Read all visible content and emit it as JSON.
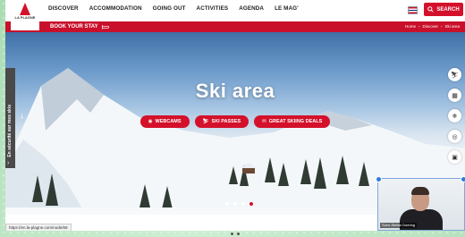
{
  "nav": {
    "items": [
      "DISCOVER",
      "ACCOMMODATION",
      "GOING OUT",
      "ACTIVITIES",
      "AGENDA",
      "LE MAG'"
    ],
    "search_label": "SEARCH"
  },
  "logo": {
    "text": "LA PLAGNE"
  },
  "subbar": {
    "book_label": "BOOK YOUR STAY",
    "breadcrumb": [
      "Home",
      "Discover",
      "Ski area"
    ]
  },
  "hero": {
    "title": "Ski area",
    "buttons": [
      "WEBCAMS",
      "SKI PASSES",
      "GREAT SKIING DEALS"
    ],
    "side_tab": "En sécurité sur mes skis",
    "slides": 4,
    "active_slide": 4
  },
  "status_bar": {
    "url": "https://en.la-plagne.com/node/69"
  },
  "video": {
    "name": "Sven-Stefan Doering"
  },
  "colors": {
    "brand_red": "#d4112b",
    "backdrop_green": "#bfe3c4"
  },
  "icons": {
    "right_rail": [
      "skier-icon",
      "map-icon",
      "snow-condition-icon",
      "webcam-icon",
      "bus-icon"
    ]
  }
}
